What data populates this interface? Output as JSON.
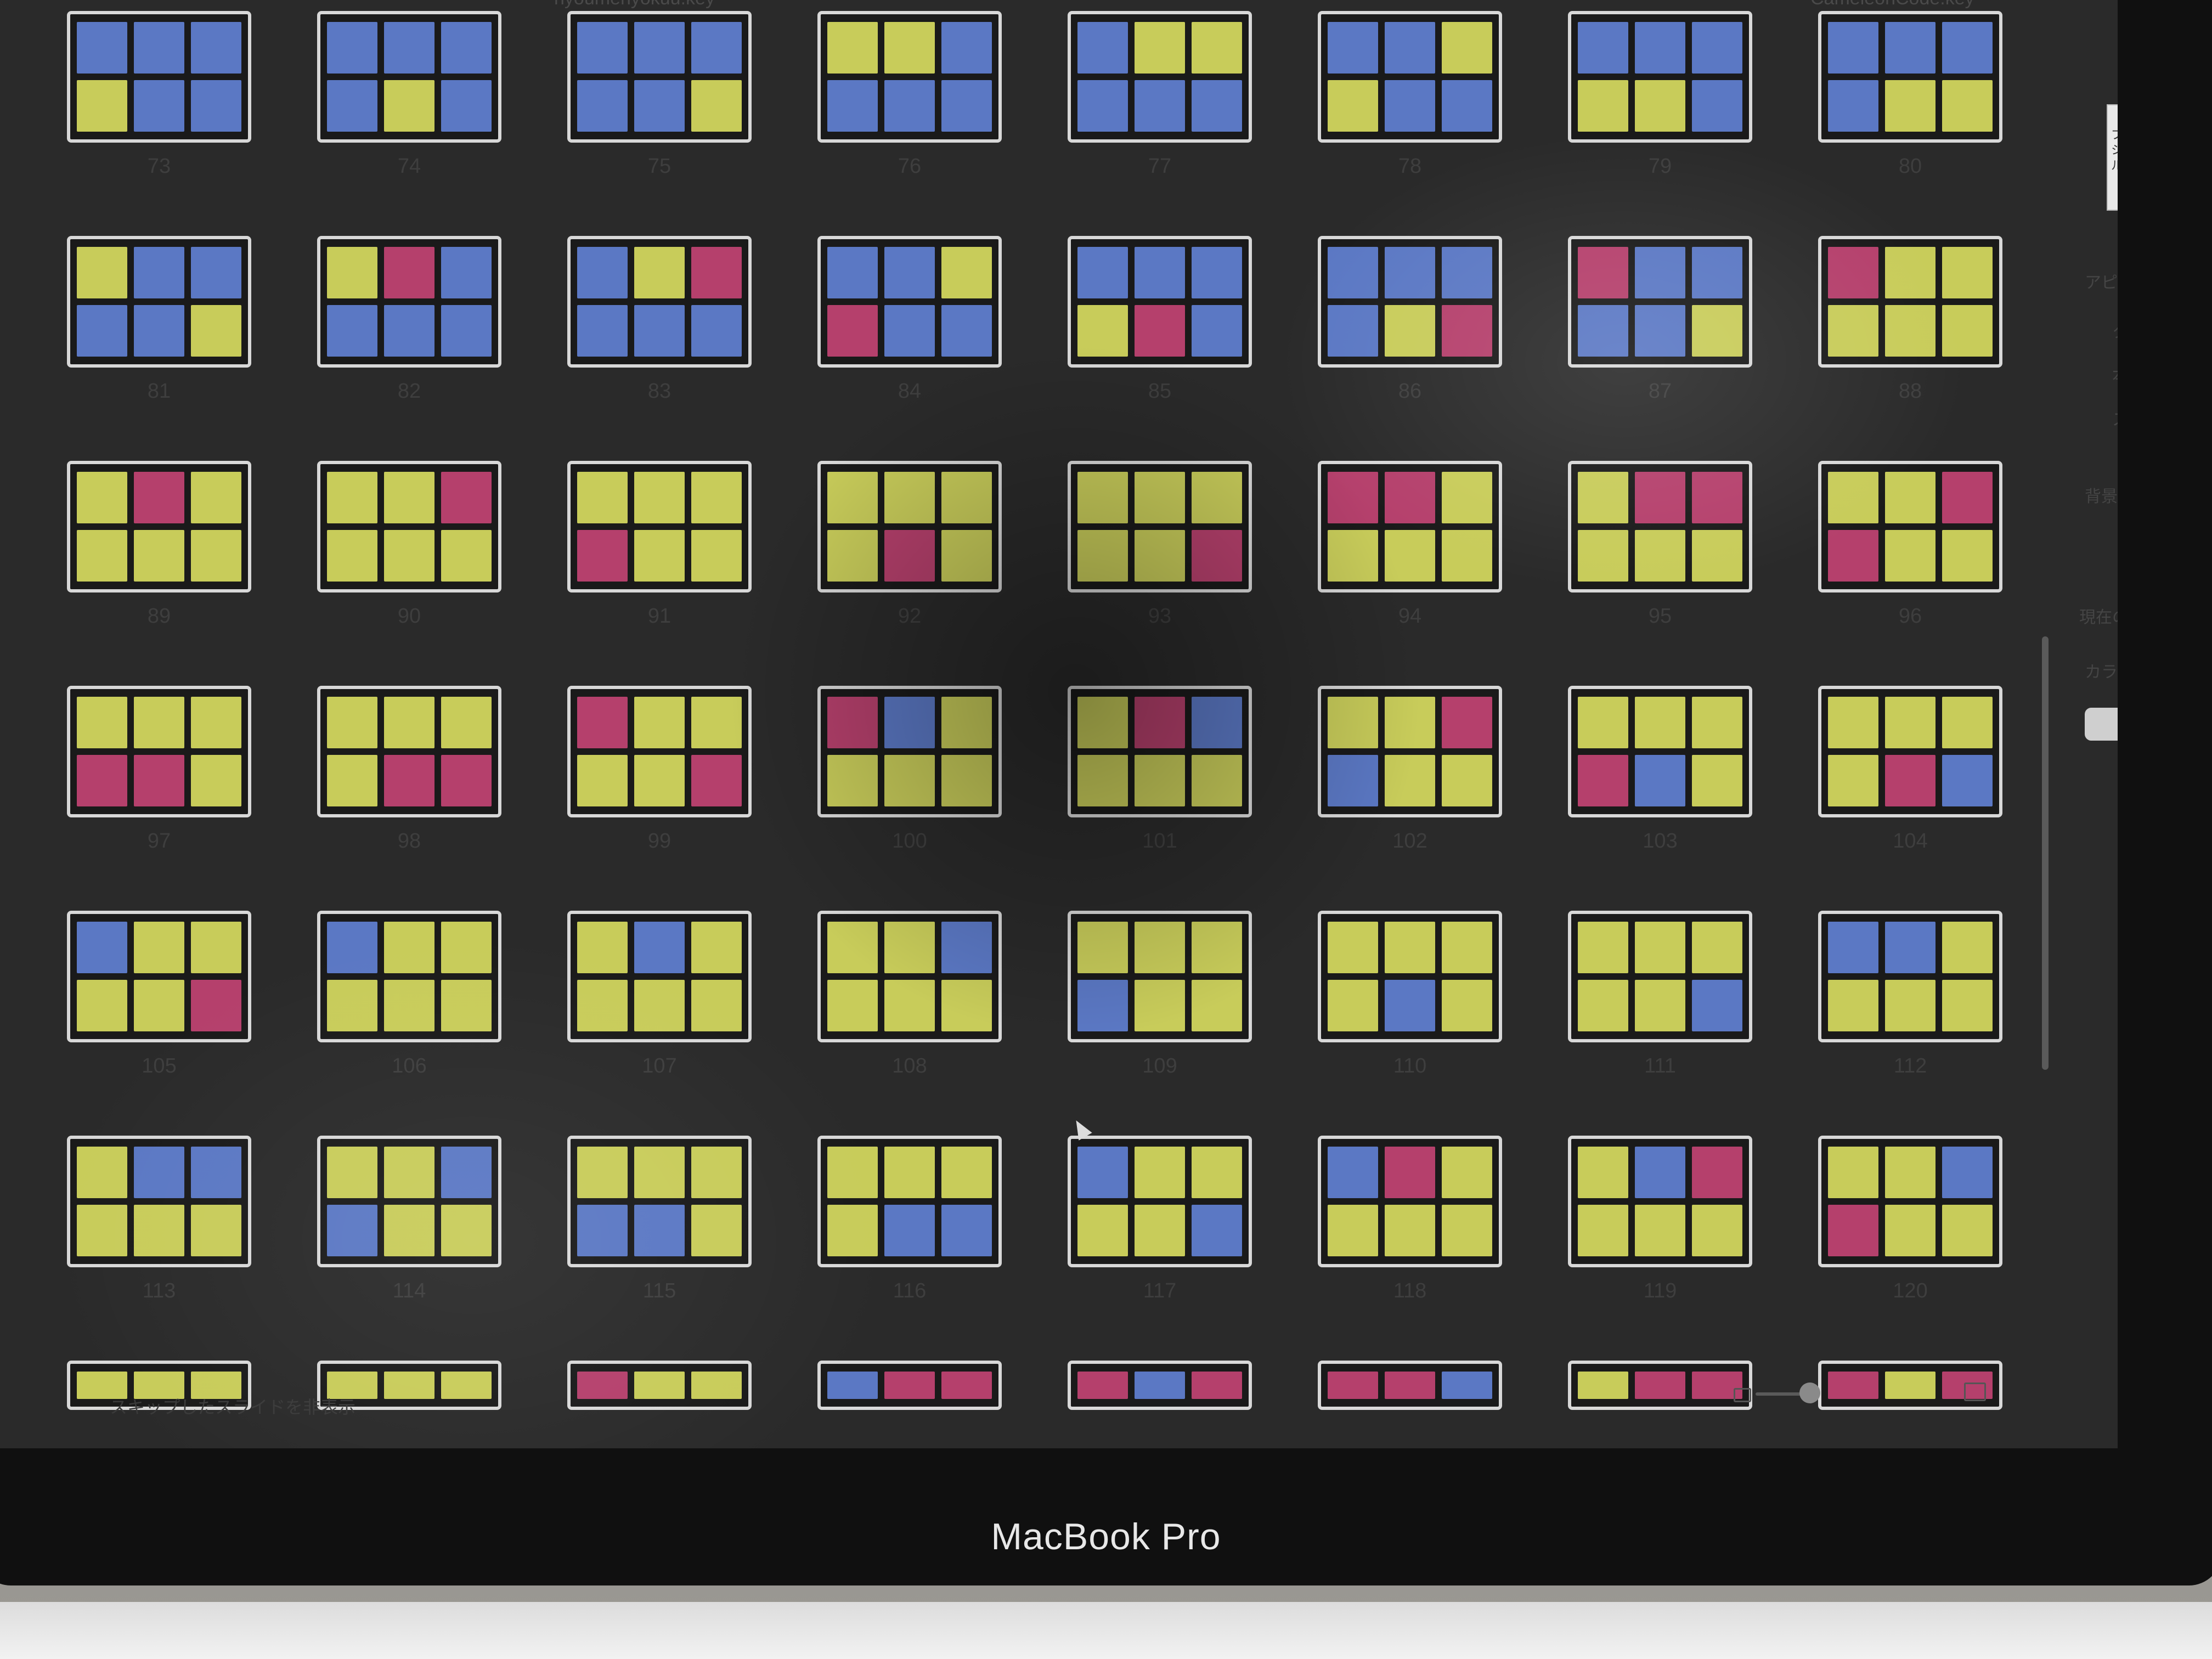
{
  "window": {
    "title_left": "hyoumenyokuu.key",
    "title_right": "CameleonCode.key"
  },
  "colors": {
    "yellow": "#c8cc5a",
    "blue": "#5b78c4",
    "pink": "#b5406c"
  },
  "slides": [
    {
      "number": "73",
      "tiles": [
        "b",
        "b",
        "b",
        "y",
        "b",
        "b"
      ]
    },
    {
      "number": "74",
      "tiles": [
        "b",
        "b",
        "b",
        "b",
        "y",
        "b"
      ]
    },
    {
      "number": "75",
      "tiles": [
        "b",
        "b",
        "b",
        "b",
        "b",
        "y"
      ]
    },
    {
      "number": "76",
      "tiles": [
        "y",
        "y",
        "b",
        "b",
        "b",
        "b"
      ]
    },
    {
      "number": "77",
      "tiles": [
        "b",
        "y",
        "y",
        "b",
        "b",
        "b"
      ]
    },
    {
      "number": "78",
      "tiles": [
        "b",
        "b",
        "y",
        "y",
        "b",
        "b"
      ]
    },
    {
      "number": "79",
      "tiles": [
        "b",
        "b",
        "b",
        "y",
        "y",
        "b"
      ]
    },
    {
      "number": "80",
      "tiles": [
        "b",
        "b",
        "b",
        "b",
        "y",
        "y"
      ]
    },
    {
      "number": "81",
      "tiles": [
        "y",
        "b",
        "b",
        "b",
        "b",
        "y"
      ]
    },
    {
      "number": "82",
      "tiles": [
        "y",
        "p",
        "b",
        "b",
        "b",
        "b"
      ]
    },
    {
      "number": "83",
      "tiles": [
        "b",
        "y",
        "p",
        "b",
        "b",
        "b"
      ]
    },
    {
      "number": "84",
      "tiles": [
        "b",
        "b",
        "y",
        "p",
        "b",
        "b"
      ]
    },
    {
      "number": "85",
      "tiles": [
        "b",
        "b",
        "b",
        "y",
        "p",
        "b"
      ]
    },
    {
      "number": "86",
      "tiles": [
        "b",
        "b",
        "b",
        "b",
        "y",
        "p"
      ]
    },
    {
      "number": "87",
      "tiles": [
        "p",
        "b",
        "b",
        "b",
        "b",
        "y"
      ]
    },
    {
      "number": "88",
      "tiles": [
        "p",
        "y",
        "y",
        "y",
        "y",
        "y"
      ]
    },
    {
      "number": "89",
      "tiles": [
        "y",
        "p",
        "y",
        "y",
        "y",
        "y"
      ]
    },
    {
      "number": "90",
      "tiles": [
        "y",
        "y",
        "p",
        "y",
        "y",
        "y"
      ]
    },
    {
      "number": "91",
      "tiles": [
        "y",
        "y",
        "y",
        "p",
        "y",
        "y"
      ]
    },
    {
      "number": "92",
      "tiles": [
        "y",
        "y",
        "y",
        "y",
        "p",
        "y"
      ]
    },
    {
      "number": "93",
      "tiles": [
        "y",
        "y",
        "y",
        "y",
        "y",
        "p"
      ]
    },
    {
      "number": "94",
      "tiles": [
        "p",
        "p",
        "y",
        "y",
        "y",
        "y"
      ]
    },
    {
      "number": "95",
      "tiles": [
        "y",
        "p",
        "p",
        "y",
        "y",
        "y"
      ]
    },
    {
      "number": "96",
      "tiles": [
        "y",
        "y",
        "p",
        "p",
        "y",
        "y"
      ]
    },
    {
      "number": "97",
      "tiles": [
        "y",
        "y",
        "y",
        "p",
        "p",
        "y"
      ]
    },
    {
      "number": "98",
      "tiles": [
        "y",
        "y",
        "y",
        "y",
        "p",
        "p"
      ]
    },
    {
      "number": "99",
      "tiles": [
        "p",
        "y",
        "y",
        "y",
        "y",
        "p"
      ]
    },
    {
      "number": "100",
      "tiles": [
        "p",
        "b",
        "y",
        "y",
        "y",
        "y"
      ]
    },
    {
      "number": "101",
      "tiles": [
        "y",
        "p",
        "b",
        "y",
        "y",
        "y"
      ]
    },
    {
      "number": "102",
      "tiles": [
        "y",
        "y",
        "p",
        "b",
        "y",
        "y"
      ]
    },
    {
      "number": "103",
      "tiles": [
        "y",
        "y",
        "y",
        "p",
        "b",
        "y"
      ]
    },
    {
      "number": "104",
      "tiles": [
        "y",
        "y",
        "y",
        "y",
        "p",
        "b"
      ]
    },
    {
      "number": "105",
      "tiles": [
        "b",
        "y",
        "y",
        "y",
        "y",
        "p"
      ]
    },
    {
      "number": "106",
      "tiles": [
        "b",
        "y",
        "y",
        "y",
        "y",
        "y"
      ]
    },
    {
      "number": "107",
      "tiles": [
        "y",
        "b",
        "y",
        "y",
        "y",
        "y"
      ]
    },
    {
      "number": "108",
      "tiles": [
        "y",
        "y",
        "b",
        "y",
        "y",
        "y"
      ]
    },
    {
      "number": "109",
      "tiles": [
        "y",
        "y",
        "y",
        "b",
        "y",
        "y"
      ]
    },
    {
      "number": "110",
      "tiles": [
        "y",
        "y",
        "y",
        "y",
        "b",
        "y"
      ]
    },
    {
      "number": "111",
      "tiles": [
        "y",
        "y",
        "y",
        "y",
        "y",
        "b"
      ]
    },
    {
      "number": "112",
      "tiles": [
        "b",
        "b",
        "y",
        "y",
        "y",
        "y"
      ]
    },
    {
      "number": "113",
      "tiles": [
        "y",
        "b",
        "b",
        "y",
        "y",
        "y"
      ]
    },
    {
      "number": "114",
      "tiles": [
        "y",
        "y",
        "b",
        "b",
        "y",
        "y"
      ]
    },
    {
      "number": "115",
      "tiles": [
        "y",
        "y",
        "y",
        "b",
        "b",
        "y"
      ]
    },
    {
      "number": "116",
      "tiles": [
        "y",
        "y",
        "y",
        "y",
        "b",
        "b"
      ]
    },
    {
      "number": "117",
      "tiles": [
        "b",
        "y",
        "y",
        "y",
        "y",
        "b"
      ]
    },
    {
      "number": "118",
      "tiles": [
        "b",
        "p",
        "y",
        "y",
        "y",
        "y"
      ]
    },
    {
      "number": "119",
      "tiles": [
        "y",
        "b",
        "p",
        "y",
        "y",
        "y"
      ]
    },
    {
      "number": "120",
      "tiles": [
        "y",
        "y",
        "b",
        "p",
        "y",
        "y"
      ]
    },
    {
      "number": "",
      "tiles": [
        "y",
        "y",
        "y"
      ]
    },
    {
      "number": "",
      "tiles": [
        "y",
        "y",
        "y"
      ]
    },
    {
      "number": "",
      "tiles": [
        "p",
        "y",
        "y"
      ]
    },
    {
      "number": "",
      "tiles": [
        "b",
        "p",
        "p"
      ]
    },
    {
      "number": "",
      "tiles": [
        "p",
        "b",
        "p"
      ]
    },
    {
      "number": "",
      "tiles": [
        "p",
        "p",
        "b"
      ]
    },
    {
      "number": "",
      "tiles": [
        "y",
        "p",
        "p"
      ]
    },
    {
      "number": "",
      "tiles": [
        "p",
        "y",
        "p"
      ]
    }
  ],
  "inspector": {
    "preview_text": "プレゼンテーションタイトル",
    "section_appearance": "アピアランス",
    "opt_title": "タイトル",
    "opt_body": "本文",
    "opt_slide_number": "スライド番号",
    "section_background": "背景",
    "section_current_fill": "現在の塗りつぶし",
    "fill_type": "カラー塗りつぶし"
  },
  "status": {
    "text": "スキップしたスライドを非表示"
  },
  "hardware": {
    "label": "MacBook Pro"
  }
}
